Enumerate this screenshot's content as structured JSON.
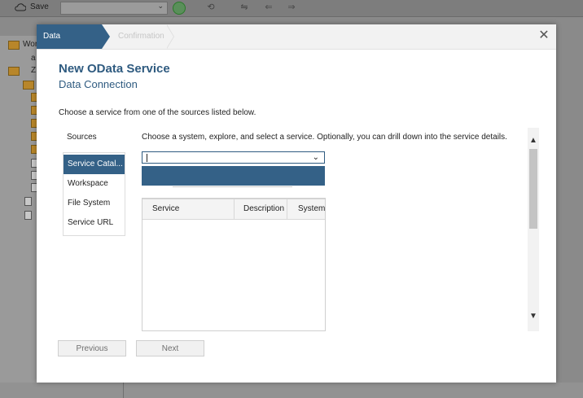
{
  "background": {
    "toolbar": {
      "save_label": "Save"
    },
    "tree": {
      "item_labels": [
        "Wor",
        "a",
        "Z"
      ]
    }
  },
  "wizard": {
    "steps": [
      {
        "label": "Data Connection",
        "active": true
      },
      {
        "label": "Confirmation",
        "active": false
      }
    ],
    "close_icon": "close-icon"
  },
  "dialog": {
    "title": "New OData Service",
    "subtitle": "Data Connection",
    "instructions": "Choose a service from one of the sources listed below."
  },
  "sources": {
    "heading": "Sources",
    "items": [
      {
        "label": "Service Catal...",
        "selected": true
      },
      {
        "label": "Workspace",
        "selected": false
      },
      {
        "label": "File System",
        "selected": false
      },
      {
        "label": "Service URL",
        "selected": false
      }
    ]
  },
  "catalog": {
    "instructions": "Choose a system, explore, and select a service. Optionally, you can drill down into the service details.",
    "system_value": "",
    "table": {
      "columns": [
        "Service",
        "Description",
        "System"
      ],
      "rows": []
    }
  },
  "footer": {
    "previous_label": "Previous",
    "next_label": "Next"
  },
  "colors": {
    "accent": "#346187",
    "title": "#2f5b80",
    "button_disabled_text": "#6f6f6f"
  }
}
